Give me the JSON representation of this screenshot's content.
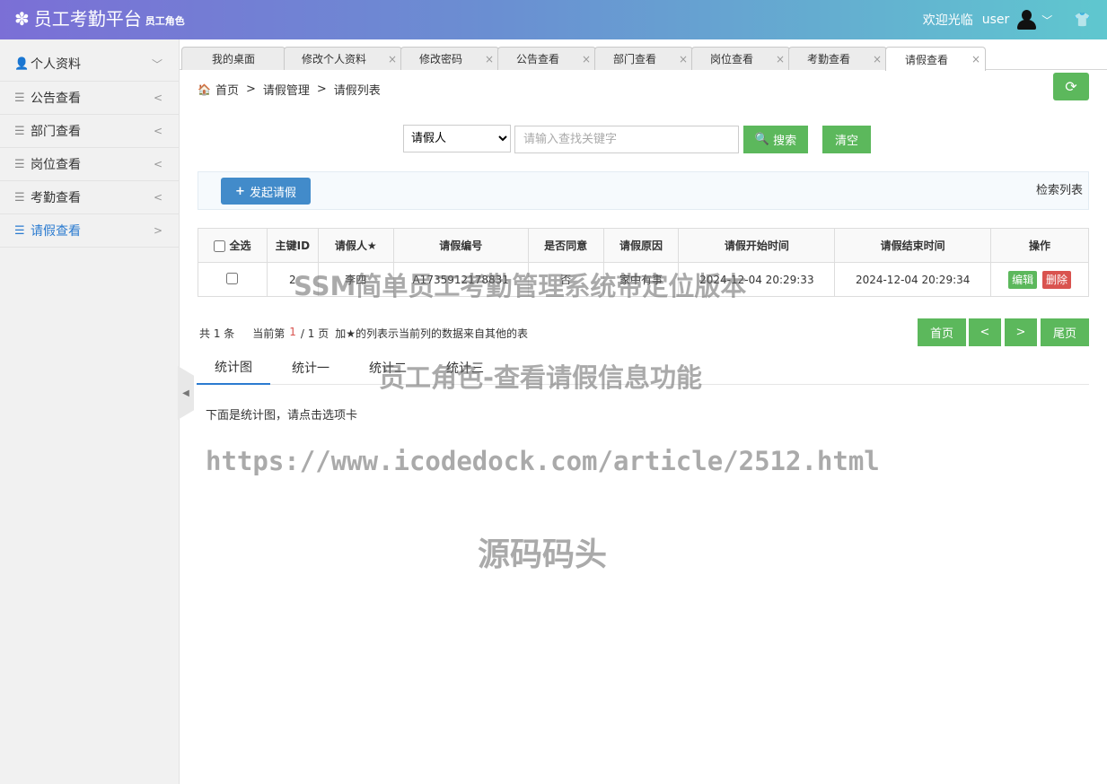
{
  "header": {
    "gear_icon": "gear-icon",
    "title": "员工考勤平台",
    "role": "员工角色",
    "welcome": "欢迎光临",
    "username": "user"
  },
  "sidebar": {
    "items": [
      {
        "label": "个人资料",
        "arrow": "﹀"
      },
      {
        "label": "公告查看",
        "arrow": "<"
      },
      {
        "label": "部门查看",
        "arrow": "<"
      },
      {
        "label": "岗位查看",
        "arrow": "<"
      },
      {
        "label": "考勤查看",
        "arrow": "<"
      },
      {
        "label": "请假查看",
        "arrow": ">"
      }
    ]
  },
  "tabs": [
    {
      "label": "我的桌面"
    },
    {
      "label": "修改个人资料"
    },
    {
      "label": "修改密码"
    },
    {
      "label": "公告查看"
    },
    {
      "label": "部门查看"
    },
    {
      "label": "岗位查看"
    },
    {
      "label": "考勤查看"
    },
    {
      "label": "请假查看"
    }
  ],
  "breadcrumb": {
    "home": "首页",
    "level1": "请假管理",
    "level2": "请假列表"
  },
  "search": {
    "select_value": "请假人",
    "placeholder": "请输入查找关键字",
    "search_label": "搜索",
    "clear_label": "清空"
  },
  "toolbar": {
    "add_label": "发起请假",
    "caption": "检索列表"
  },
  "table": {
    "headers": {
      "select_all": "全选",
      "id": "主键ID",
      "applicant": "请假人★",
      "number": "请假编号",
      "approved": "是否同意",
      "reason": "请假原因",
      "start": "请假开始时间",
      "end": "请假结束时间",
      "ops": "操作"
    },
    "rows": [
      {
        "id": "2",
        "applicant": "李四",
        "number": "A1735912178831",
        "approved": "否",
        "reason": "家中有事",
        "start": "2024-12-04 20:29:33",
        "end": "2024-12-04 20:29:34",
        "edit": "编辑",
        "delete": "删除"
      }
    ]
  },
  "pager": {
    "total": "共 1 条",
    "current_prefix": "当前第",
    "current": "1",
    "current_suffix": "/ 1 页",
    "note": "加★的列表示当前列的数据来自其他的表",
    "first": "首页",
    "prev": "<",
    "next": ">",
    "last": "尾页"
  },
  "stats": {
    "tabs": [
      "统计图",
      "统计一",
      "统计二",
      "统计三"
    ],
    "hint": "下面是统计图，请点击选项卡"
  },
  "watermarks": {
    "line1": "SSM简单员工考勤管理系统带定位版本",
    "line2": "员工角色-查看请假信息功能",
    "line3": "https://www.icodedock.com/article/2512.html",
    "line4": "源码码头"
  }
}
